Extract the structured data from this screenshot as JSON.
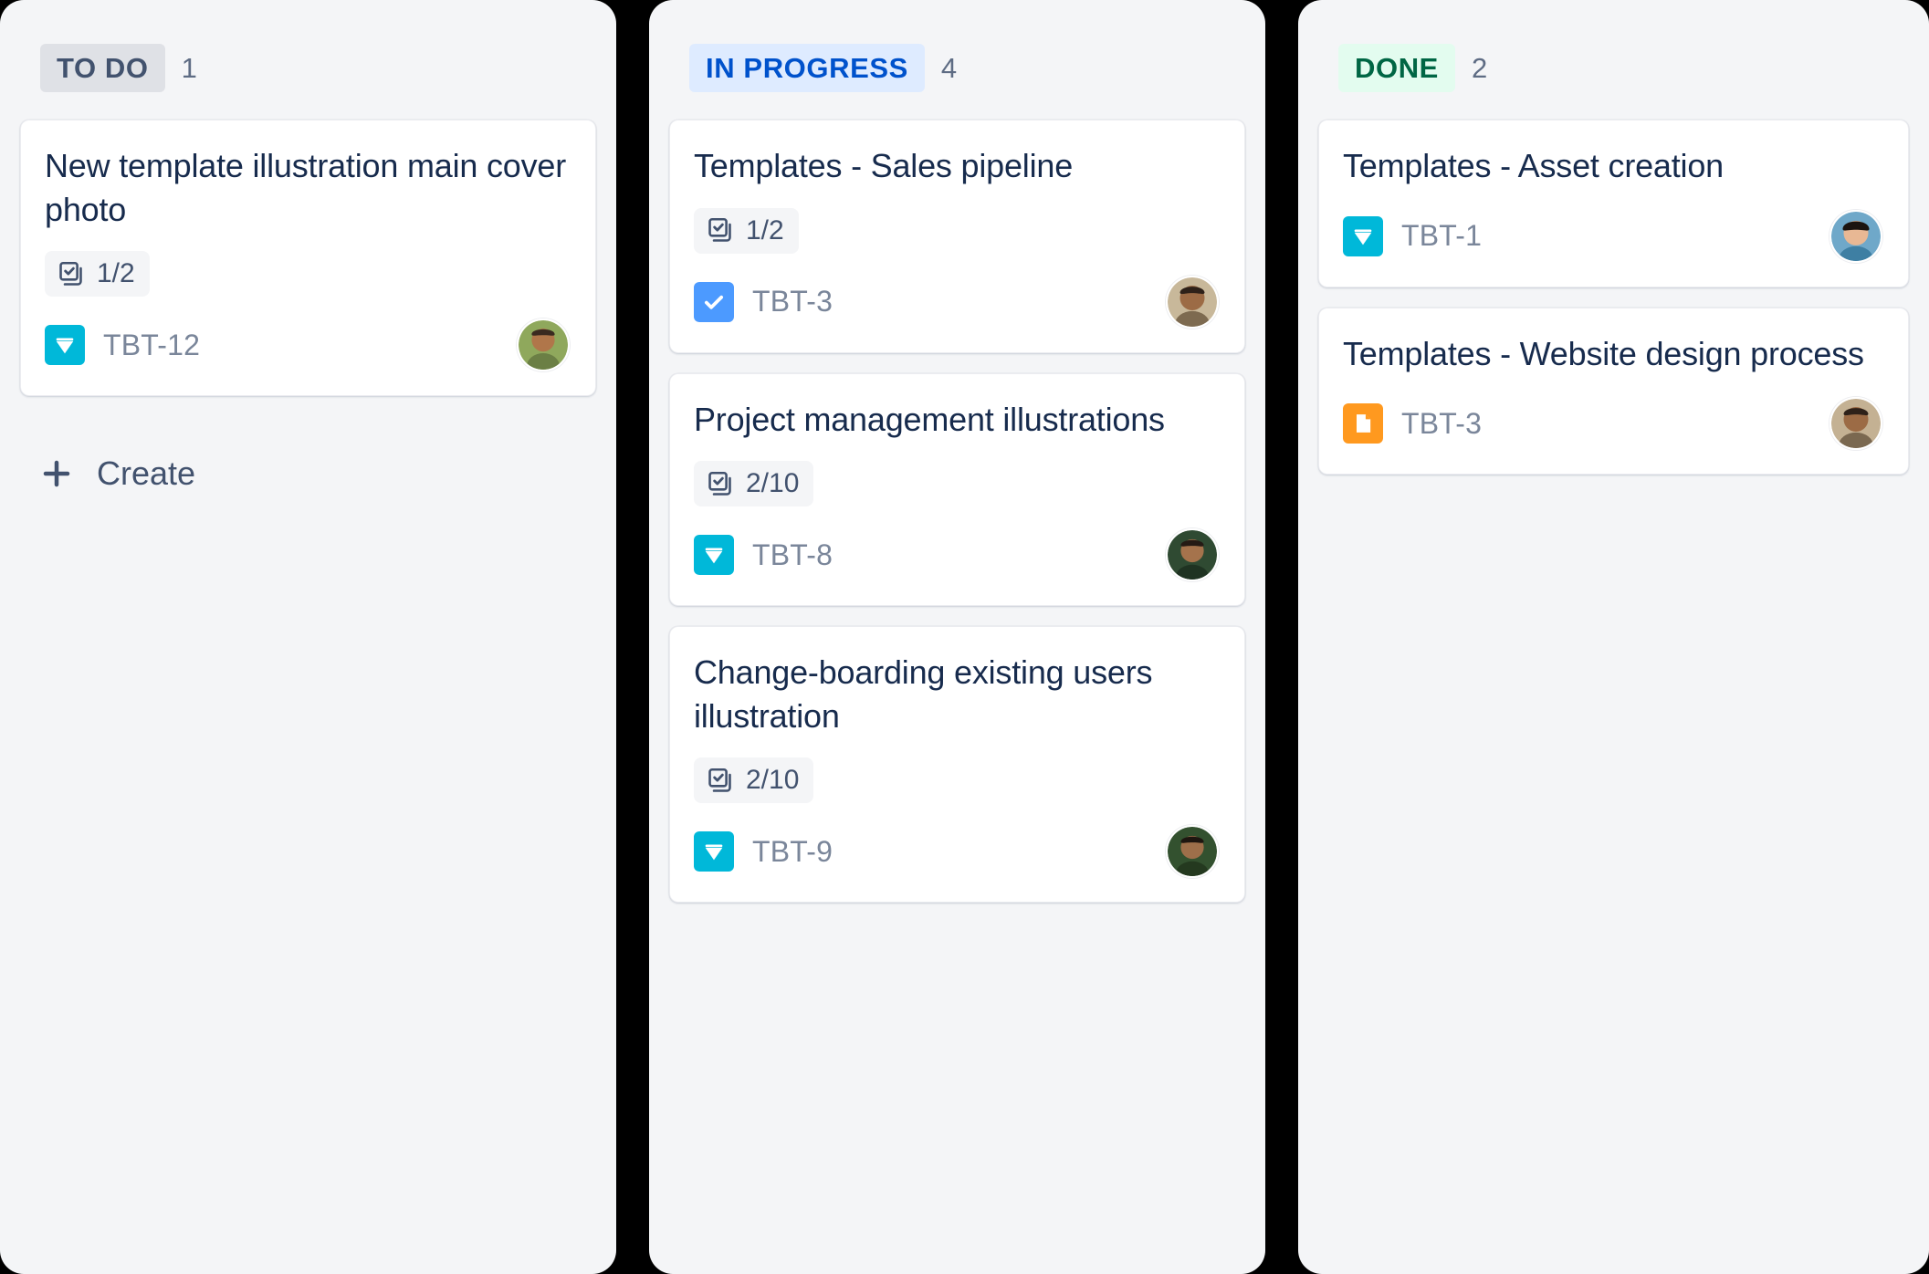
{
  "board": {
    "columns": [
      {
        "id": "todo",
        "status_label": "TO DO",
        "count": "1",
        "badge_bg": "#dfe1e6",
        "badge_color": "#42526e",
        "create_label": "Create",
        "create_icon": "plus-icon",
        "cards": [
          {
            "title": "New template illustration main cover photo",
            "checklist": "1/2",
            "checklist_icon": "checklist-icon",
            "issue_key": "TBT-12",
            "type_icon": "story-icon",
            "type_color": "#00b8d9",
            "avatar": "avatar-photo"
          }
        ]
      },
      {
        "id": "in-progress",
        "status_label": "IN PROGRESS",
        "count": "4",
        "badge_bg": "#deebff",
        "badge_color": "#0052cc",
        "cards": [
          {
            "title": "Templates - Sales pipeline",
            "checklist": "1/2",
            "checklist_icon": "checklist-icon",
            "issue_key": "TBT-3",
            "type_icon": "subtask-icon",
            "type_color": "#4c9aff",
            "avatar": "avatar-photo"
          },
          {
            "title": "Project management illustrations",
            "checklist": "2/10",
            "checklist_icon": "checklist-icon",
            "issue_key": "TBT-8",
            "type_icon": "story-icon",
            "type_color": "#00b8d9",
            "avatar": "avatar-photo"
          },
          {
            "title": "Change-boarding existing users illustration",
            "checklist": "2/10",
            "checklist_icon": "checklist-icon",
            "issue_key": "TBT-9",
            "type_icon": "story-icon",
            "type_color": "#00b8d9",
            "avatar": "avatar-photo"
          }
        ]
      },
      {
        "id": "done",
        "status_label": "DONE",
        "count": "2",
        "badge_bg": "#e3fcef",
        "badge_color": "#006644",
        "cards": [
          {
            "title": "Templates - Asset creation",
            "checklist": null,
            "issue_key": "TBT-1",
            "type_icon": "story-icon",
            "type_color": "#00b8d9",
            "avatar": "avatar-photo"
          },
          {
            "title": "Templates - Website design process",
            "checklist": null,
            "issue_key": "TBT-3",
            "type_icon": "task-page-icon",
            "type_color": "#ff991f",
            "avatar": "avatar-photo"
          }
        ]
      }
    ]
  }
}
